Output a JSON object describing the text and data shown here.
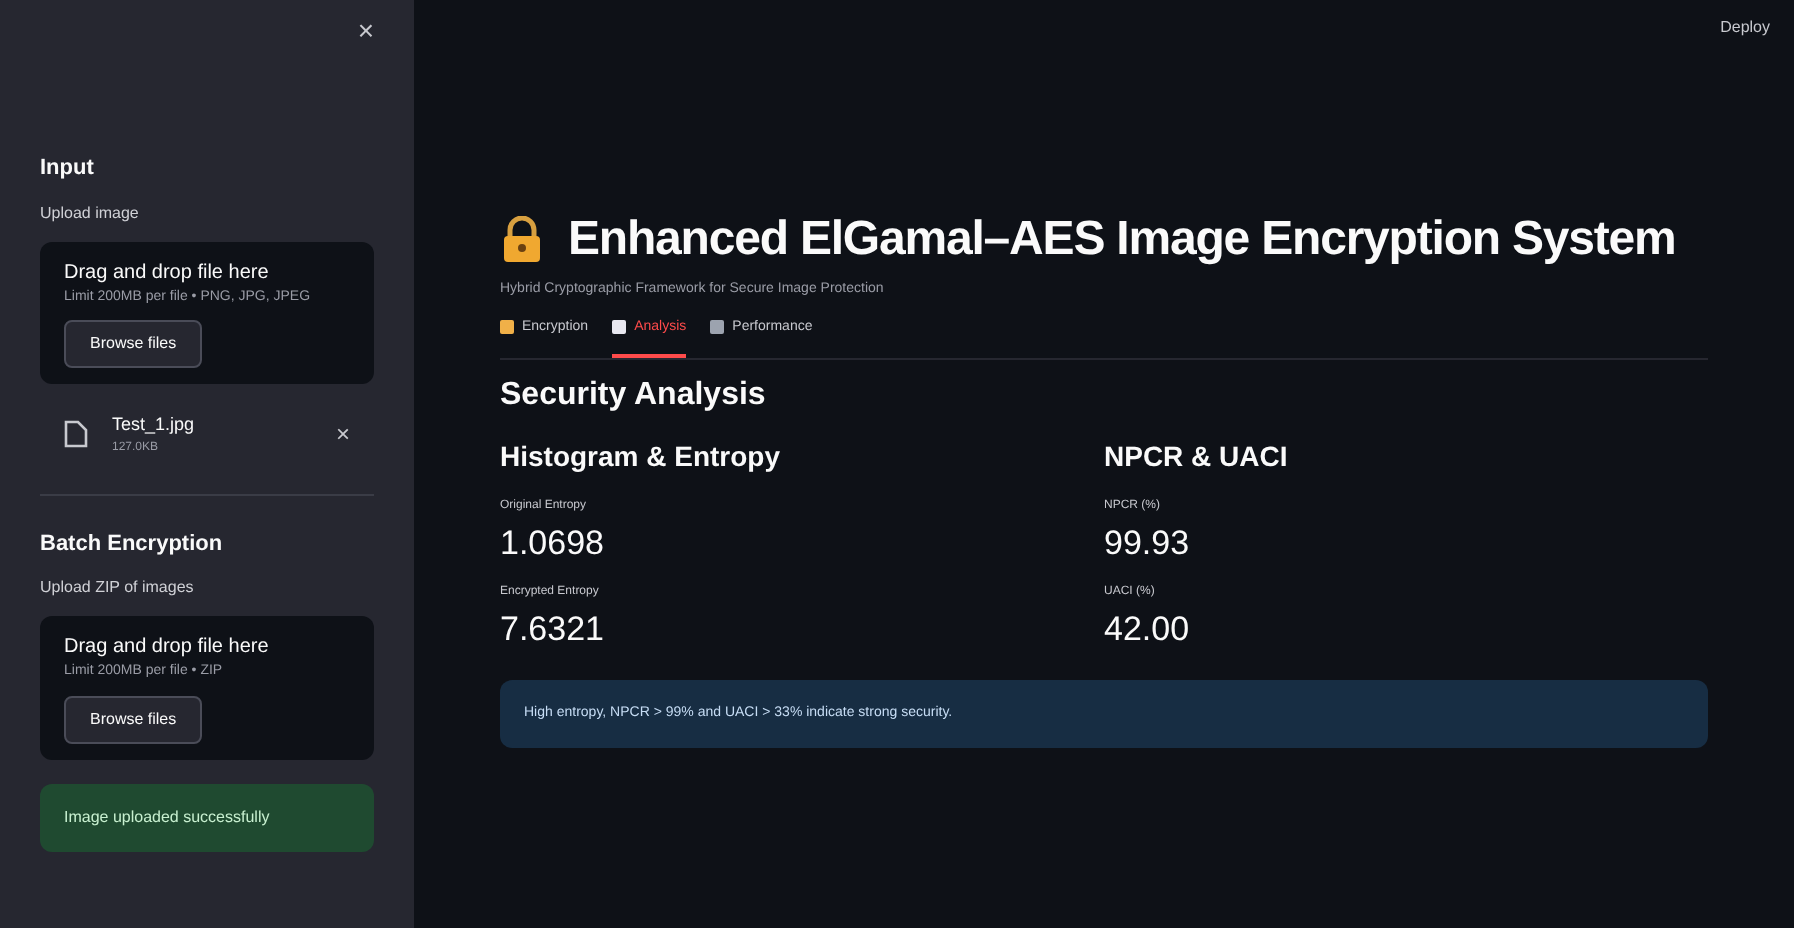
{
  "sidebar": {
    "close": "×",
    "sections": [
      {
        "title": "Input",
        "label": "Upload image",
        "dropzone": {
          "title": "Drag and drop file here",
          "hint": "Limit 200MB per file • PNG, JPG, JPEG",
          "button": "Browse files"
        },
        "file": {
          "name": "Test_1.jpg",
          "size": "127.0KB",
          "remove": "×"
        }
      },
      {
        "title": "Batch Encryption",
        "label": "Upload ZIP of images",
        "dropzone": {
          "title": "Drag and drop file here",
          "hint": "Limit 200MB per file • ZIP",
          "button": "Browse files"
        }
      }
    ],
    "success": "Image uploaded successfully"
  },
  "header": {
    "deploy": "Deploy"
  },
  "main": {
    "title": "Enhanced ElGamal–AES Image Encryption System",
    "subtitle": "Hybrid Cryptographic Framework for Secure Image Protection",
    "tabs": [
      {
        "label": "Encryption",
        "selected": false
      },
      {
        "label": "Analysis",
        "selected": true
      },
      {
        "label": "Performance",
        "selected": false
      }
    ],
    "heading": "Security Analysis",
    "columns": [
      {
        "title": "Histogram & Entropy",
        "metrics": [
          {
            "label": "Original Entropy",
            "value": "1.0698"
          },
          {
            "label": "Encrypted Entropy",
            "value": "7.6321"
          }
        ]
      },
      {
        "title": "NPCR & UACI",
        "metrics": [
          {
            "label": "NPCR (%)",
            "value": "99.93"
          },
          {
            "label": "UACI (%)",
            "value": "42.00"
          }
        ]
      }
    ],
    "info": "High entropy, NPCR > 99% and UACI > 33% indicate strong security."
  }
}
